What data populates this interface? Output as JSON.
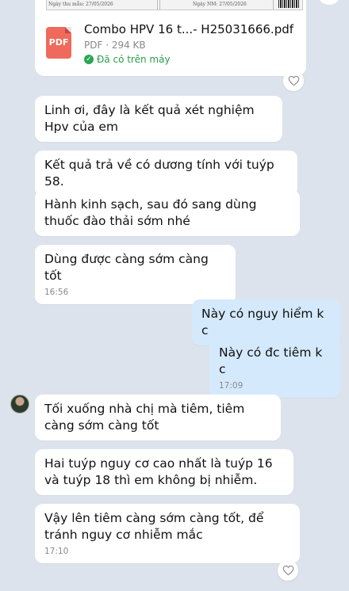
{
  "file_card": {
    "doc_preview": {
      "date_received": "Ngày thu mẫu: 27/05/2026",
      "date_result": "Ngày NM: 27/05/2026"
    },
    "icon_label": "PDF",
    "file_name": "Combo HPV 16 t...- H25031666.pdf",
    "file_meta": "PDF · 294 KB",
    "status": "Đã có trên máy"
  },
  "messages": [
    {
      "text": "Linh ơi, đây là kết quả xét nghiệm Hpv của em"
    },
    {
      "text": "Kết quả trả về có dương tính với tuýp 58."
    },
    {
      "text": "Hành kinh sạch, sau đó sang dùng thuốc đào thải sớm nhé"
    },
    {
      "text": "Dùng được càng sớm càng tốt",
      "time": "16:56"
    },
    {
      "text": "Này có nguy hiểm k c"
    },
    {
      "text": "Này có đc tiêm k c",
      "time": "17:09"
    },
    {
      "text": "Tối xuống nhà chị mà tiêm, tiêm càng sớm càng tốt"
    },
    {
      "text": "Hai tuýp nguy cơ cao nhất là tuýp 16 và tuýp 18 thì em không bị nhiễm."
    },
    {
      "text": "Vậy lên tiêm càng sớm càng tốt, để tránh nguy cơ nhiễm mắc",
      "time": "17:10"
    }
  ],
  "icons": {
    "reaction": "heart-icon",
    "status": "check-circle-icon",
    "file": "pdf-icon"
  },
  "colors": {
    "background": "#dde3ec",
    "incoming_bubble": "#ffffff",
    "outgoing_bubble": "#d4e9fb",
    "status_green": "#2a9d4a",
    "pdf_red": "#ef6a5c"
  }
}
